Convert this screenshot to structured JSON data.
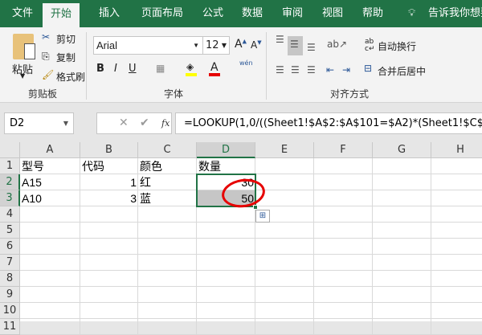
{
  "tabs": [
    "文件",
    "开始",
    "插入",
    "页面布局",
    "公式",
    "数据",
    "审阅",
    "视图",
    "帮助"
  ],
  "tell_me": "告诉我你想要",
  "clipboard": {
    "paste": "粘贴",
    "cut": "剪切",
    "copy": "复制",
    "format_painter": "格式刷",
    "group": "剪贴板"
  },
  "font": {
    "name": "Arial",
    "size": "12",
    "bold": "B",
    "italic": "I",
    "underline": "U",
    "phonetic": "wén",
    "group": "字体"
  },
  "alignment": {
    "wrap": "自动换行",
    "merge": "合并后居中",
    "group": "对齐方式"
  },
  "formula_bar": {
    "name_box": "D2",
    "fx": "fx",
    "formula": "=LOOKUP(1,0/((Sheet1!$A$2:$A$101=$A2)*(Sheet1!$C$"
  },
  "columns": [
    "A",
    "B",
    "C",
    "D",
    "E",
    "F",
    "G",
    "H"
  ],
  "rows": [
    "1",
    "2",
    "3",
    "4",
    "5",
    "6",
    "7",
    "8",
    "9",
    "10",
    "11"
  ],
  "cells": [
    [
      "型号",
      "代码",
      "颜色",
      "数量"
    ],
    [
      "A15",
      "1",
      "红",
      "30"
    ],
    [
      "A10",
      "3",
      "蓝",
      "50"
    ]
  ],
  "colors": {
    "brand": "#217346",
    "highlight": "#e60000"
  }
}
